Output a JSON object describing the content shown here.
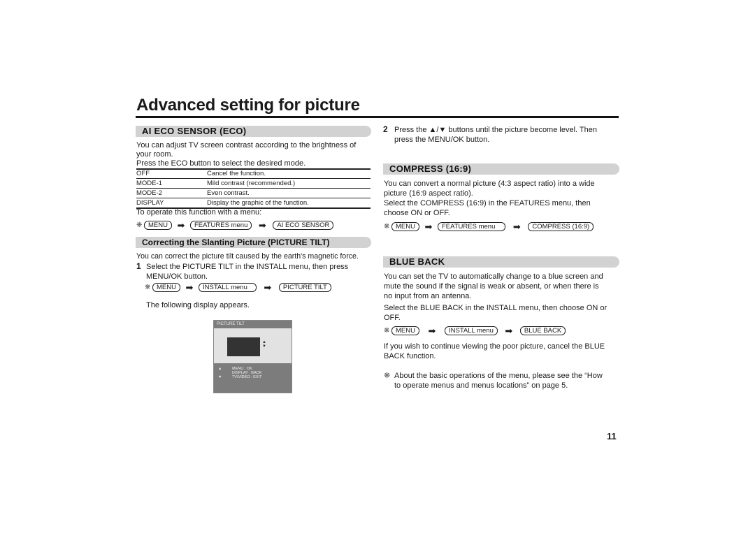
{
  "page": {
    "title": "Advanced setting for picture",
    "page_number": "11"
  },
  "eco": {
    "heading": "AI ECO SENSOR (ECO)",
    "intro_1": "You can adjust TV screen contrast according to the brightness of",
    "intro_2": "your room.",
    "intro_3": "Press the ECO button to select the desired mode.",
    "modes": [
      {
        "mode": "OFF",
        "desc": "Cancel the function."
      },
      {
        "mode": "MODE-1",
        "desc": "Mild contrast (recommended.)"
      },
      {
        "mode": "MODE-2",
        "desc": "Even contrast."
      },
      {
        "mode": "DISPLAY",
        "desc": "Display the graphic of the function."
      }
    ],
    "menu_note": "To operate this function with a menu:",
    "flow": [
      "MENU",
      "FEATURES menu",
      "AI ECO SENSOR"
    ]
  },
  "tilt": {
    "heading": "Correcting the Slanting Picture (PICTURE TILT)",
    "intro": "You can correct the picture tilt caused by the earth's magnetic force.",
    "step1_num": "1",
    "step1_a": "Select the PICTURE TILT in the INSTALL menu, then press",
    "step1_b": "MENU/OK button.",
    "flow": [
      "MENU",
      "INSTALL menu",
      "PICTURE TILT"
    ],
    "display_note": "The following display appears.",
    "osd": {
      "title": "PICTURE TILT",
      "up_arrow": "▲",
      "down_arrow": "▼",
      "lines": [
        "MENU : OK",
        "DISPLAY : BACK",
        "TV/VIDEO : EXIT"
      ]
    },
    "step2_num": "2",
    "step2_a": "Press the ▲/▼ buttons until the picture become level. Then",
    "step2_b": "press the MENU/OK button."
  },
  "compress": {
    "heading": "COMPRESS (16:9)",
    "text_1": "You can convert a normal picture (4:3 aspect ratio) into a wide",
    "text_2": "picture (16:9 aspect ratio).",
    "text_3": "Select the COMPRESS (16:9) in the FEATURES menu, then",
    "text_4": "choose ON or OFF.",
    "flow": [
      "MENU",
      "FEATURES menu",
      "COMPRESS (16:9)"
    ]
  },
  "blueback": {
    "heading": "BLUE BACK",
    "text_1": "You can set the TV to automatically change to a blue screen and",
    "text_2": "mute the sound if the signal is weak or absent, or when there is",
    "text_3": "no input from an antenna.",
    "text_4": "Select the BLUE BACK in the INSTALL menu, then choose ON or",
    "text_5": "OFF.",
    "flow": [
      "MENU",
      "INSTALL menu",
      "BLUE BACK"
    ],
    "text_6": "If you wish to continue viewing the poor picture, cancel the BLUE",
    "text_7": "BACK function."
  },
  "footnote": {
    "symbol": "❋",
    "line_1": "About the basic operations of the menu, please see the “How",
    "line_2": "to operate menus and menus locations” on page 5."
  },
  "symbols": {
    "star": "❋",
    "arrow": "➡"
  }
}
